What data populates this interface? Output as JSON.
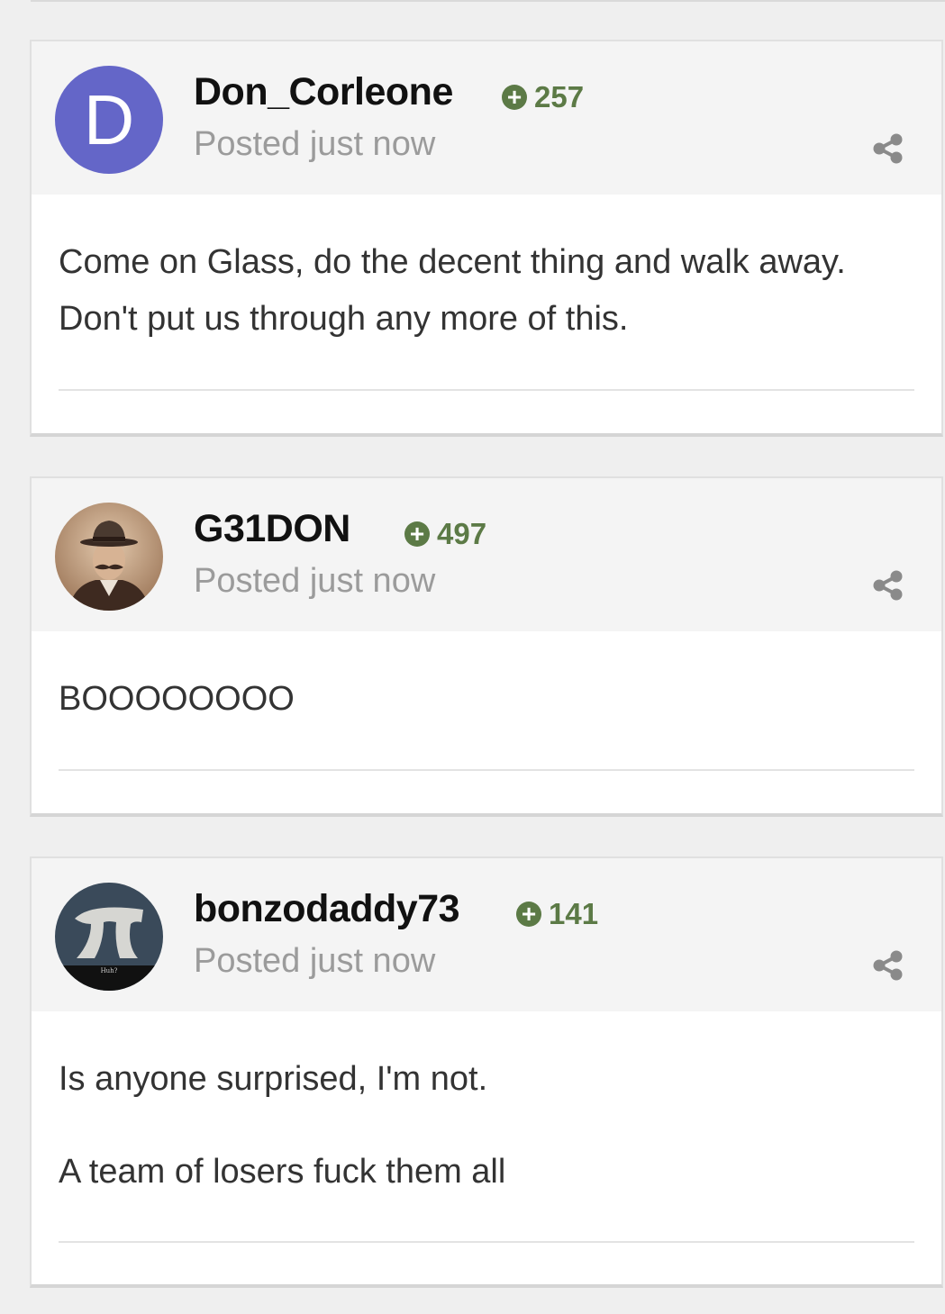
{
  "posts": [
    {
      "username": "Don_Corleone",
      "avatar_letter": "D",
      "avatar_color": "#6466c8",
      "reputation_icon": "plus-circle-icon",
      "reputation": "257",
      "posted": "Posted just now",
      "paragraphs": [
        "Come on Glass, do the decent thing and walk away.",
        "Don't put us through any more of this."
      ]
    },
    {
      "username": "G31DON",
      "avatar_image": "vintage photo of a mustached man in a bowler hat",
      "reputation_icon": "plus-circle-icon",
      "reputation": "497",
      "posted": "Posted just now",
      "paragraphs": [
        "BOOOOOOOO"
      ]
    },
    {
      "username": "bonzodaddy73",
      "avatar_image": "grey sculpted pi symbol on dark background",
      "reputation_icon": "plus-circle-icon",
      "reputation": "141",
      "posted": "Posted just now",
      "paragraphs": [
        "Is anyone surprised, I'm not.",
        "A team of losers fuck them all"
      ]
    }
  ],
  "colors": {
    "accent_reputation": "#5c7a46",
    "header_background": "#f4f4f4",
    "page_background": "#efefef"
  }
}
